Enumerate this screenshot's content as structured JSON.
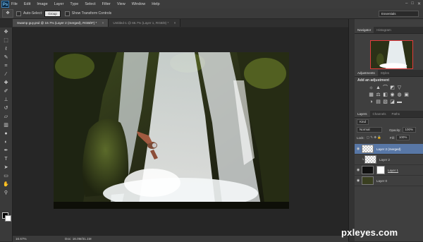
{
  "app": {
    "logo": "Ps",
    "menu": [
      "File",
      "Edit",
      "Image",
      "Layer",
      "Type",
      "Select",
      "Filter",
      "View",
      "Window",
      "Help"
    ],
    "window_controls": [
      "–",
      "□",
      "✕"
    ]
  },
  "options_bar": {
    "tool_icon": "move-icon",
    "auto_select_label": "Auto-Select:",
    "auto_select_value": "Group",
    "transform_label": "Show Transform Controls",
    "workspace": "Essentials"
  },
  "tabs": [
    {
      "label": "Swamp guy.psd @ 16.7% (Layer 2 (merged), RGB/8*) *",
      "close": "×",
      "active": true
    },
    {
      "label": "Untitled-1 @ 66.7% (Layer 1, RGB/8) *",
      "close": "×",
      "active": false
    }
  ],
  "tools": [
    "move-icon",
    "marquee-icon",
    "lasso-icon",
    "quick-select-icon",
    "crop-icon",
    "eyedropper-icon",
    "healing-icon",
    "brush-icon",
    "stamp-icon",
    "history-brush-icon",
    "eraser-icon",
    "gradient-icon",
    "blur-icon",
    "dodge-icon",
    "pen-icon",
    "type-icon",
    "path-select-icon",
    "shape-icon",
    "hand-icon",
    "zoom-icon"
  ],
  "status": {
    "zoom": "16.67%",
    "doc": "Doc: 16.0M/31.1M"
  },
  "navigator": {
    "tab": "Navigator",
    "tab2": "Histogram",
    "zoom": "16.67%"
  },
  "adjustments": {
    "tab": "Adjustments",
    "tab2": "Styles",
    "title": "Add an adjustment"
  },
  "layers_panel": {
    "tabs": [
      "Layers",
      "Channels",
      "Paths"
    ],
    "kind": "Kind",
    "blend_mode": "Normal",
    "opacity_label": "Opacity:",
    "opacity_value": "100%",
    "lock_label": "Lock:",
    "fill_label": "Fill:",
    "fill_value": "100%",
    "layers": [
      {
        "name": "Layer 2 (merged)",
        "selected": true
      },
      {
        "name": "Layer 2",
        "selected": false
      },
      {
        "name": "Layer 1",
        "selected": false
      },
      {
        "name": "Layer 0",
        "selected": false
      }
    ]
  },
  "watermark": "pxleyes.com"
}
